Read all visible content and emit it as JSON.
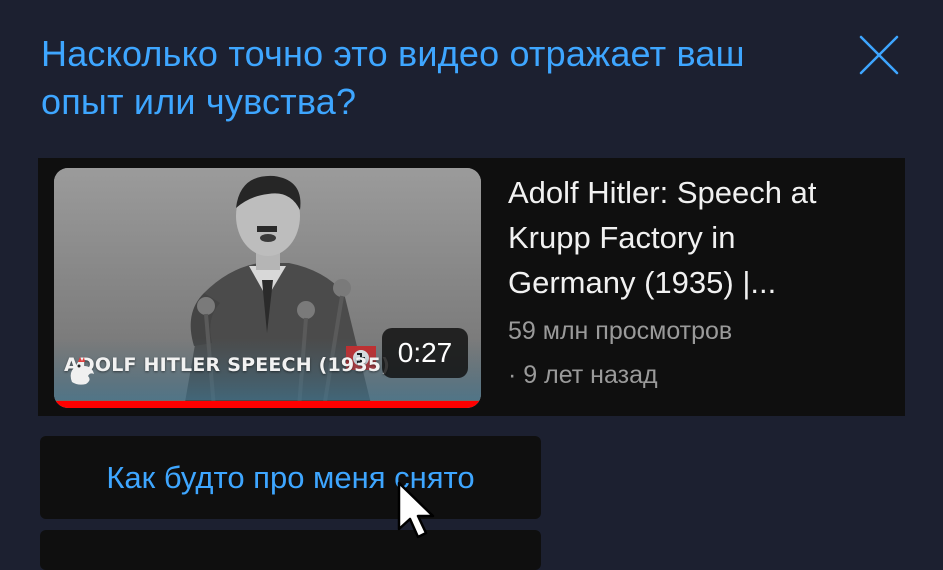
{
  "dialog": {
    "title": "Насколько точно это видео отражает ваш опыт или чувства?"
  },
  "video": {
    "thumbnail_caption": "ADOLF HITLER SPEECH (1935)",
    "duration": "0:27",
    "watch_progress": 1.0,
    "title": "Adolf Hitler: Speech at Krupp Factory in Germany (1935) |...",
    "views": "59 млн просмотров",
    "age": "· 9 лет назад"
  },
  "options": [
    {
      "label": "Как будто про меня снято"
    }
  ],
  "icons": {
    "close": "close-icon",
    "channel_logo": "rooster-logo-icon",
    "cursor": "mouse-pointer-icon"
  },
  "colors": {
    "background": "#1c2030",
    "accent": "#3ea6ff",
    "card": "#0f0f0f",
    "progress": "#ff0000",
    "secondary_text": "#9a9a9a"
  }
}
